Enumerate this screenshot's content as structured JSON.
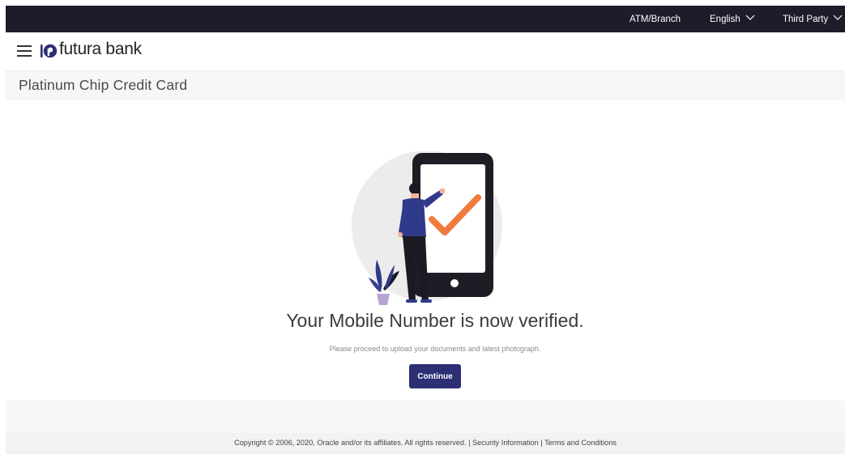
{
  "topbar": {
    "atm_branch": "ATM/Branch",
    "language": "English",
    "third_party": "Third Party"
  },
  "header": {
    "brand": "futura bank"
  },
  "page": {
    "title": "Platinum Chip Credit Card"
  },
  "main": {
    "heading": "Your Mobile Number is now verified.",
    "subtext": "Please proceed to upload your documents and latest photograph.",
    "continue_label": "Continue"
  },
  "footer": {
    "copyright": "Copyright © 2006, 2020, Oracle and/or its affiliates. All rights reserved.",
    "sep1": " | ",
    "security": "Security Information",
    "sep2": " | ",
    "terms": "Terms and Conditions"
  },
  "colors": {
    "topbar_bg": "#1c1c2a",
    "brand_accent": "#2d2f75",
    "check_orange": "#f07b3f"
  },
  "icons": [
    "hamburger-menu-icon",
    "futura-logo-icon",
    "chevron-down-icon",
    "verified-phone-illustration"
  ]
}
